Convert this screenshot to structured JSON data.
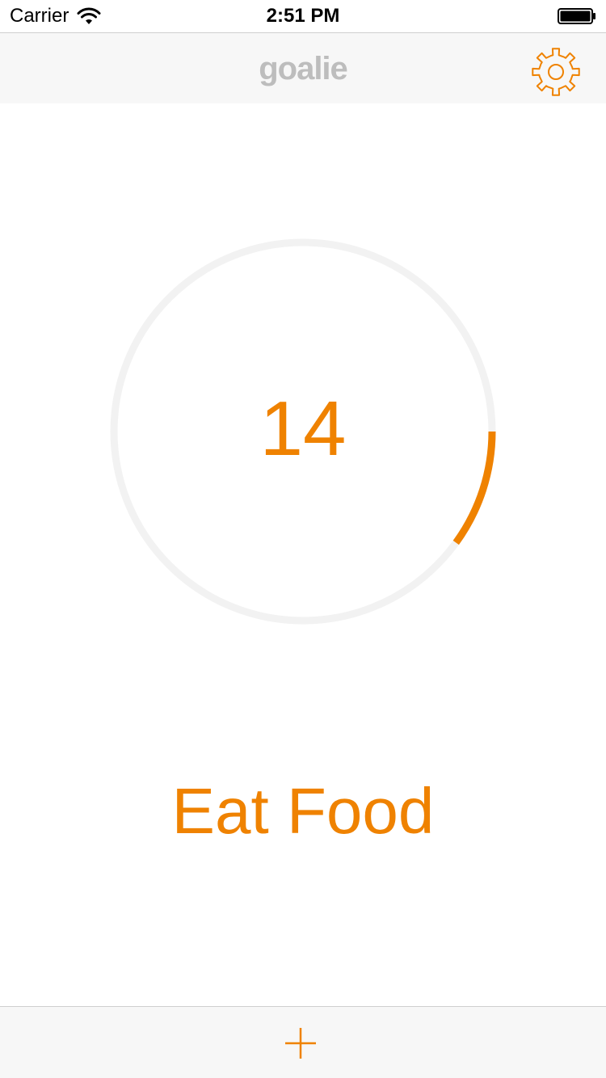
{
  "status_bar": {
    "carrier": "Carrier",
    "time": "2:51 PM",
    "wifi_icon": "wifi-icon",
    "battery_icon": "battery-icon"
  },
  "nav": {
    "title": "goalie",
    "settings_icon": "gear-icon"
  },
  "progress": {
    "count": "14",
    "fraction": 0.1,
    "track_color": "#f2f2f2",
    "fill_color": "#ef8200"
  },
  "goal": {
    "title": "Eat Food"
  },
  "toolbar": {
    "add_icon": "plus-icon"
  },
  "colors": {
    "accent": "#ef8200",
    "bar_background": "#f7f7f7",
    "title_gray": "#bdbdbd"
  }
}
